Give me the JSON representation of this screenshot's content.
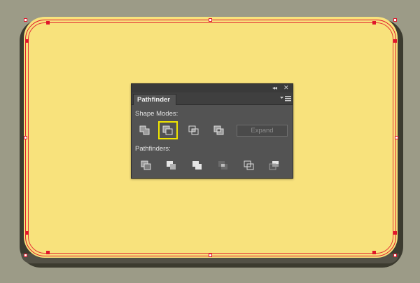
{
  "panel": {
    "title": "Pathfinder",
    "collapse_symbol": "◂◂",
    "close_symbol": "✕",
    "menu_icon": "panel-menu-icon",
    "shape_modes_label": "Shape Modes:",
    "pathfinders_label": "Pathfinders:",
    "expand_label": "Expand",
    "shape_mode_buttons": [
      "unite",
      "minus-front",
      "intersect",
      "exclude"
    ],
    "selected_shape_mode": "minus-front",
    "pathfinder_buttons": [
      "divide",
      "trim",
      "merge",
      "crop",
      "outline",
      "minus-back"
    ]
  },
  "colors": {
    "canvas_bg": "#9c9b87",
    "card_fill": "#f8e27c",
    "selection_stroke": "#e0162a",
    "highlight": "#f0e600"
  }
}
